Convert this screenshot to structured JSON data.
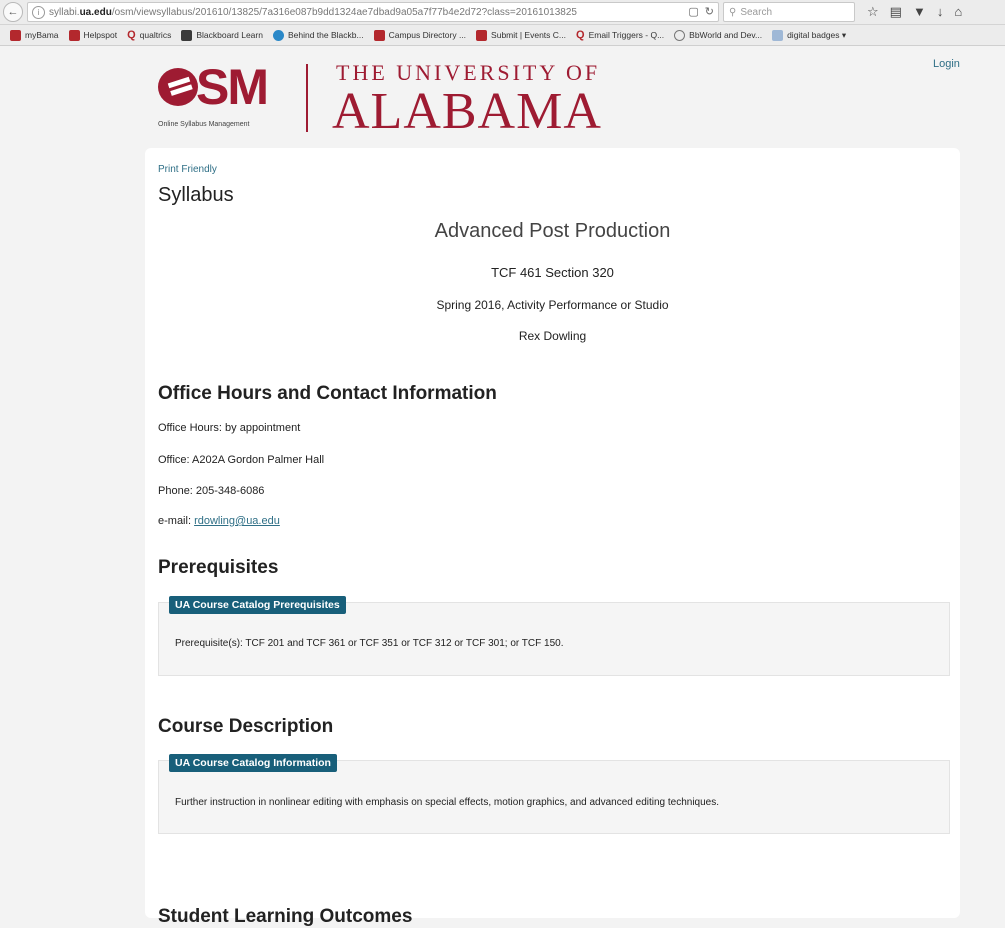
{
  "browser": {
    "url_prefix": "syllabi.",
    "url_host": "ua.edu",
    "url_path": "/osm/viewsyllabus/201610/13825/7a316e087b9dd1324ae7dbad9a05a7f77b4e2d72?class=20161013825",
    "search_placeholder": "Search",
    "bookmarks": [
      {
        "label": "myBama",
        "icon": "bama-icon"
      },
      {
        "label": "Helpspot",
        "icon": "helpspot-icon"
      },
      {
        "label": "qualtrics",
        "icon": "qualtrics-icon"
      },
      {
        "label": "Blackboard Learn",
        "icon": "blackboard-icon"
      },
      {
        "label": "Behind the Blackb...",
        "icon": "behind-blackboard-icon"
      },
      {
        "label": "Campus Directory ...",
        "icon": "bama-icon"
      },
      {
        "label": "Submit | Events C...",
        "icon": "bama-icon"
      },
      {
        "label": "Email Triggers - Q...",
        "icon": "qualtrics-icon"
      },
      {
        "label": "BbWorld and Dev...",
        "icon": "globe-icon"
      },
      {
        "label": "digital badges",
        "icon": "folder-icon"
      }
    ]
  },
  "header": {
    "login": "Login",
    "osm_logo": "SM",
    "osm_caption": "Online Syllabus Management",
    "ua_top": "THE UNIVERSITY OF",
    "ua_bottom": "ALABAMA"
  },
  "content": {
    "print_friendly": "Print Friendly",
    "heading": "Syllabus",
    "course_title": "Advanced Post Production",
    "course_section": "TCF 461 Section 320",
    "course_term": "Spring 2016, Activity Performance or Studio",
    "instructor": "Rex Dowling",
    "office": {
      "heading": "Office Hours and Contact Information",
      "hours": "Office Hours: by appointment",
      "office": "Office: A202A Gordon Palmer Hall",
      "phone": "Phone: 205-348-6086",
      "email_label": "e-mail: ",
      "email": "rdowling@ua.edu"
    },
    "prereq": {
      "heading": "Prerequisites",
      "tag": "UA Course Catalog Prerequisites",
      "text": "Prerequisite(s): TCF 201 and TCF 361 or TCF 351 or TCF 312 or TCF 301; or TCF 150."
    },
    "description": {
      "heading": "Course Description",
      "tag": "UA Course Catalog Information",
      "text": "Further instruction in nonlinear editing with emphasis on special effects, motion graphics, and advanced editing techniques."
    },
    "slo_heading": "Student Learning Outcomes"
  },
  "colors": {
    "brand_crimson": "#9e1b32",
    "tag_teal": "#185f7a",
    "link": "#2f6f86"
  }
}
